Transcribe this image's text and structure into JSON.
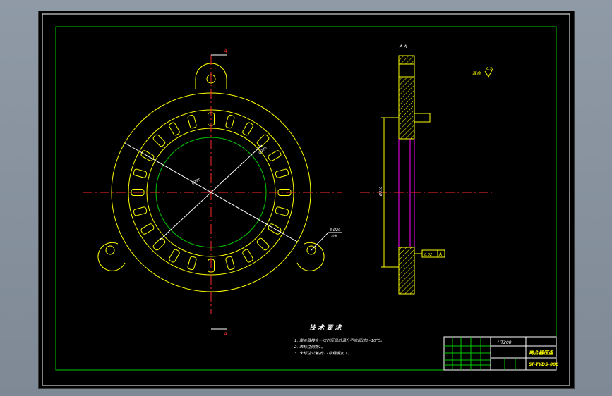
{
  "colors": {
    "background": "#000000",
    "frame": "#ffffff",
    "border": "#00c800",
    "outline": "#ffff00",
    "centerline": "#ff2a2a",
    "circle": "#00c800",
    "dimension": "#ffffff",
    "magenta": "#ff00ff"
  },
  "labels": {
    "section_a_top": "A",
    "section_a_bottom": "A",
    "section_view": "A-A",
    "dia_bolt": "Ø180",
    "dia_slot": "Ø270",
    "dim_hole": "3-Ø20",
    "dim_hole2": "均布",
    "dim_left": "Ø310",
    "datum": "A",
    "tolerance": "0.02",
    "roughness": "其余",
    "roughness_val": "6.3"
  },
  "notes": {
    "title": "技 术 要 求",
    "items": [
      "1. 离合器接合一次时压盘的温升不应超过8~10℃。",
      "2. 未标注倒角1。",
      "3. 未标注公差按IT7级精度加工。"
    ]
  },
  "title_block": {
    "material": "HT200",
    "part_name": "离合器压盘",
    "drawing_no": "SF-TYDS-006"
  }
}
